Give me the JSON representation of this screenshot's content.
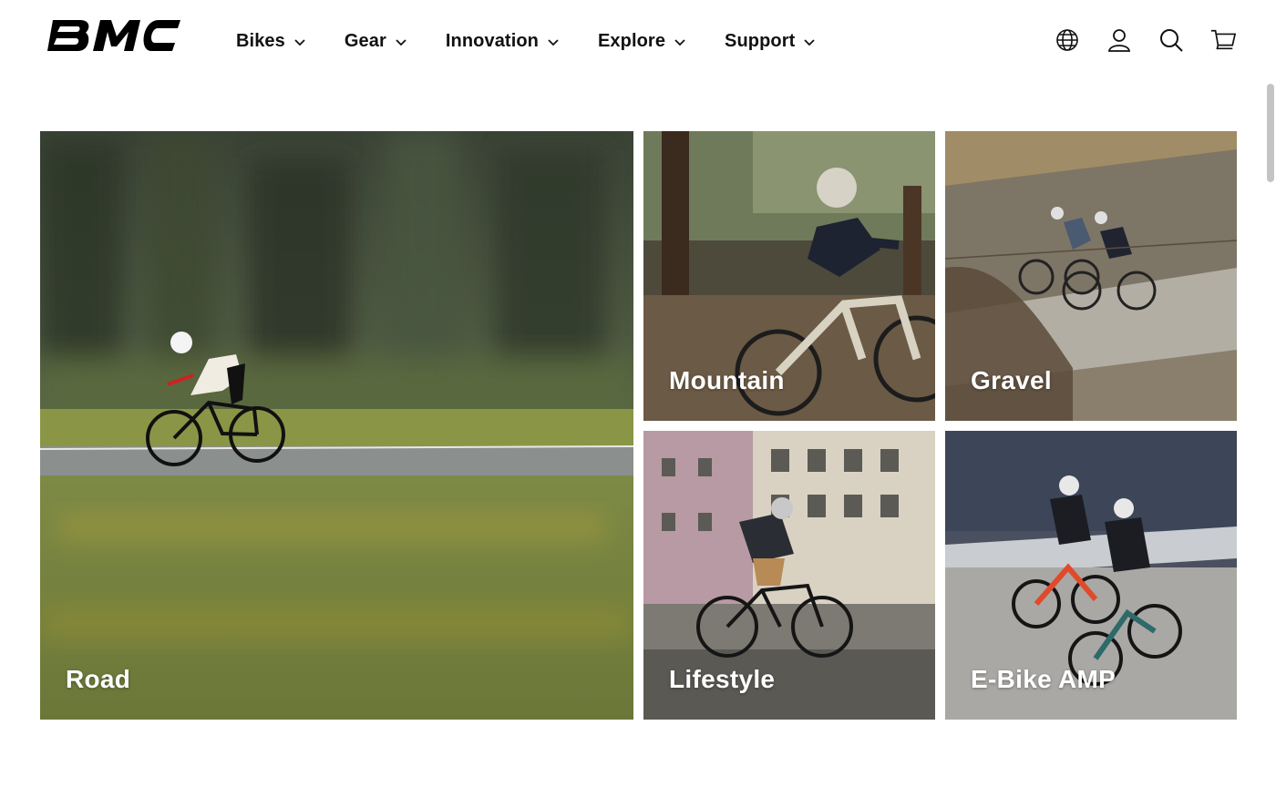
{
  "brand": {
    "logo_text": "BMC"
  },
  "nav": {
    "items": [
      {
        "label": "Bikes"
      },
      {
        "label": "Gear"
      },
      {
        "label": "Innovation"
      },
      {
        "label": "Explore"
      },
      {
        "label": "Support"
      }
    ]
  },
  "utilities": {
    "icons": [
      "globe-icon",
      "account-icon",
      "search-icon",
      "cart-icon"
    ]
  },
  "categories": [
    {
      "label": "Road"
    },
    {
      "label": "Mountain"
    },
    {
      "label": "Gravel"
    },
    {
      "label": "Lifestyle"
    },
    {
      "label": "E-Bike AMP"
    }
  ],
  "colors": {
    "text": "#111111",
    "background": "#ffffff",
    "label": "#ffffff"
  }
}
